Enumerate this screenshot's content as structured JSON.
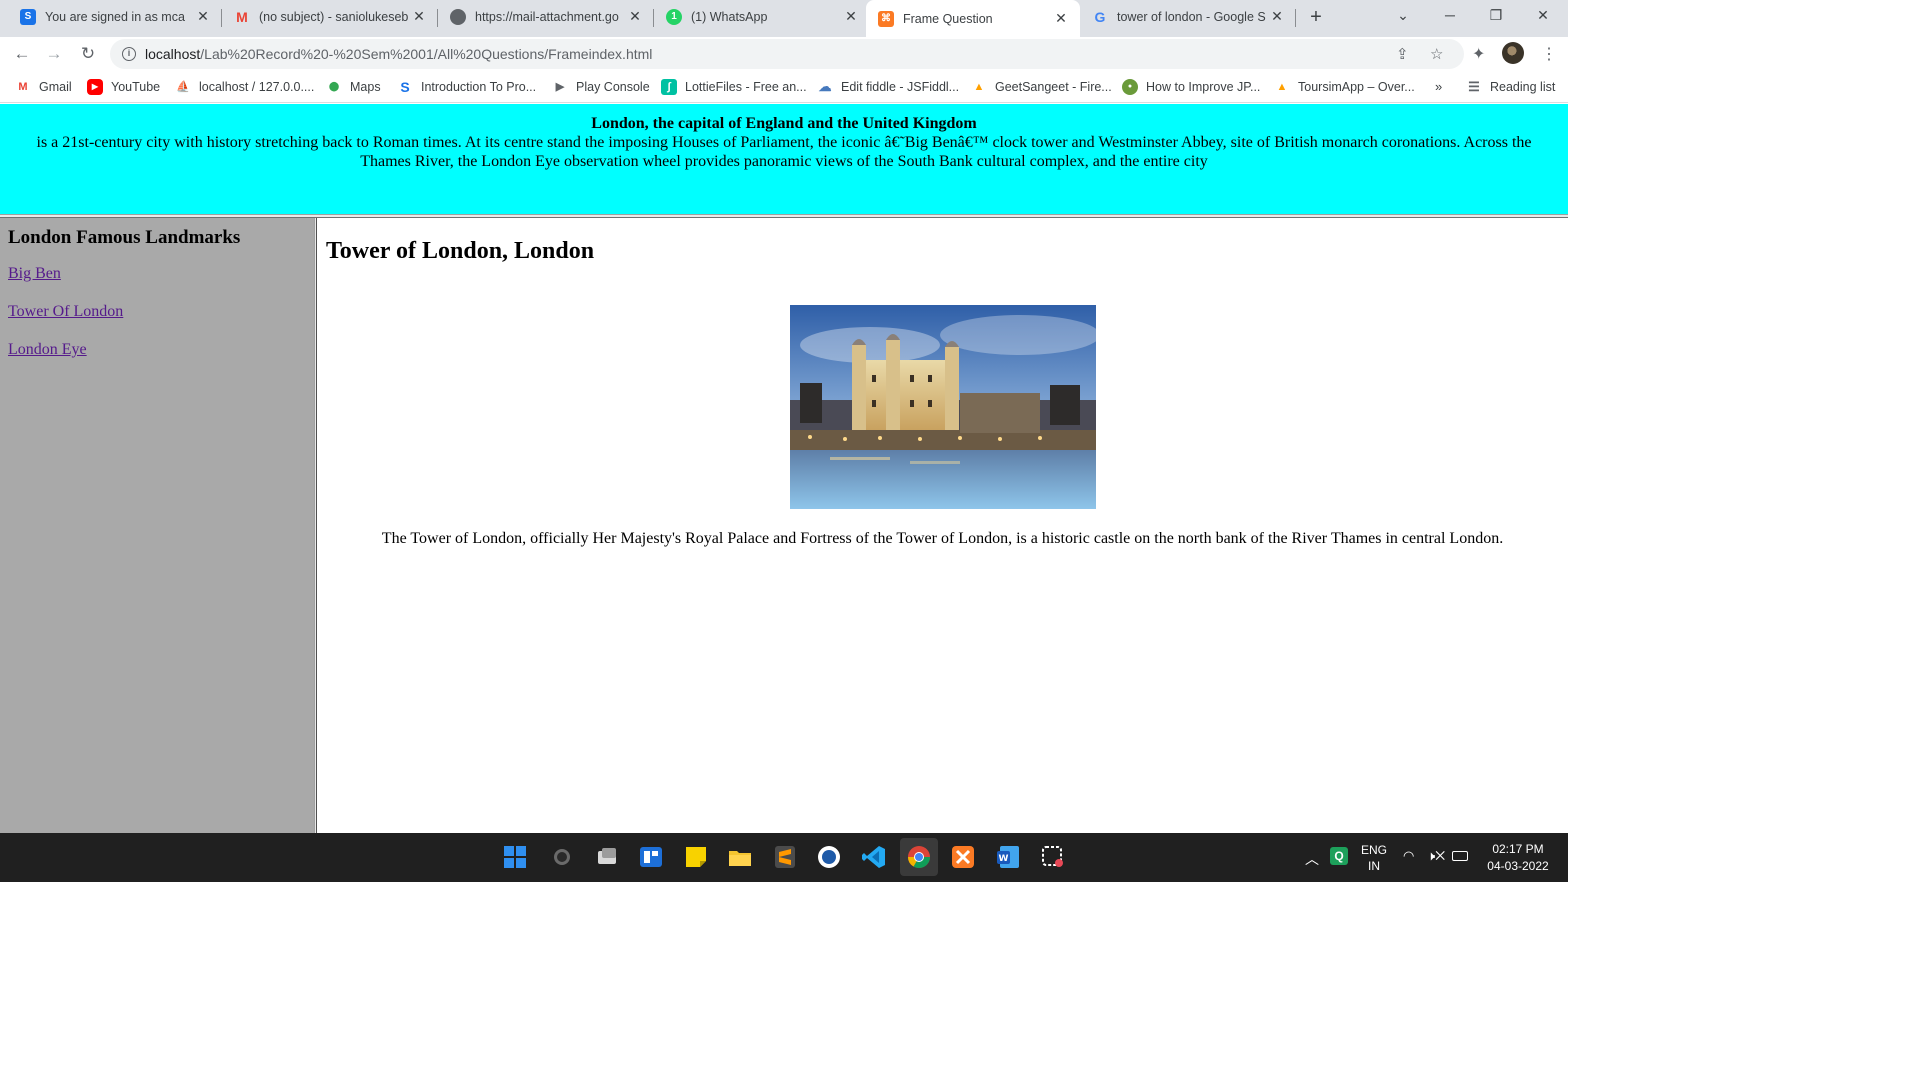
{
  "browser": {
    "tabs": [
      {
        "title": "You are signed in as mca",
        "icon": "s-icon",
        "color": "#1a73e8",
        "glyph": "S"
      },
      {
        "title": "(no subject) - saniolukeseb",
        "icon": "gmail-icon",
        "color": "#ea4335",
        "glyph": "M"
      },
      {
        "title": "https://mail-attachment.go",
        "icon": "globe-icon",
        "color": "#5f6368",
        "glyph": "●"
      },
      {
        "title": "(1) WhatsApp",
        "icon": "whatsapp-icon",
        "color": "#25d366",
        "glyph": "1"
      },
      {
        "title": "Frame Question",
        "icon": "xampp-icon",
        "color": "#fb7a24",
        "glyph": "⌘"
      },
      {
        "title": "tower of london - Google S",
        "icon": "google-icon",
        "color": "#4285f4",
        "glyph": "G"
      }
    ],
    "url_host": "localhost",
    "url_path": "/Lab%20Record%20-%20Sem%2001/All%20Questions/Frameindex.html",
    "bookmarks": [
      {
        "label": "Gmail",
        "icon": "gmail-icon",
        "glyph": "M",
        "color": "#ea4335"
      },
      {
        "label": "YouTube",
        "icon": "youtube-icon",
        "glyph": "▶",
        "color": "#ff0000"
      },
      {
        "label": "localhost / 127.0.0....",
        "icon": "phpmyadmin-icon",
        "glyph": "⛵",
        "color": "#f29111"
      },
      {
        "label": "Maps",
        "icon": "maps-icon",
        "glyph": "⬤",
        "color": "#34a853"
      },
      {
        "label": "Introduction To Pro...",
        "icon": "s-icon",
        "glyph": "S",
        "color": "#1a73e8"
      },
      {
        "label": "Play Console",
        "icon": "play-console-icon",
        "glyph": "▶",
        "color": "#5f6368"
      },
      {
        "label": "LottieFiles - Free an...",
        "icon": "lottie-icon",
        "glyph": "∫",
        "color": "#00c1a2"
      },
      {
        "label": "Edit fiddle - JSFiddl...",
        "icon": "jsfiddle-icon",
        "glyph": "☁",
        "color": "#4679bd"
      },
      {
        "label": "GeetSangeet - Fire...",
        "icon": "firebase-icon",
        "glyph": "▲",
        "color": "#ffca28"
      },
      {
        "label": "How to Improve JP...",
        "icon": "site-icon",
        "glyph": "●",
        "color": "#6a9a3a"
      },
      {
        "label": "ToursimApp – Over...",
        "icon": "firebase-icon",
        "glyph": "▲",
        "color": "#ffca28"
      }
    ],
    "more_glyph": "»",
    "reading_list": "Reading list"
  },
  "page": {
    "header": {
      "heading": "London, the capital of England and the United Kingdom",
      "body": "is a 21st-century city with history stretching back to Roman times. At its centre stand the imposing Houses of Parliament, the iconic â€˜Big Benâ€™ clock tower and Westminster Abbey, site of British monarch coronations. Across the Thames River, the London Eye observation wheel provides panoramic views of the South Bank cultural complex, and the entire city"
    },
    "sidebar": {
      "title": "London Famous Landmarks",
      "links": [
        "Big Ben",
        "Tower Of London",
        "London Eye"
      ]
    },
    "main": {
      "title": "Tower of London, London",
      "description": "The Tower of London, officially Her Majesty's Royal Palace and Fortress of the Tower of London, is a historic castle on the north bank of the River Thames in central London."
    }
  },
  "taskbar": {
    "lang_top": "ENG",
    "lang_bottom": "IN",
    "time": "02:17 PM",
    "date": "04-03-2022"
  }
}
